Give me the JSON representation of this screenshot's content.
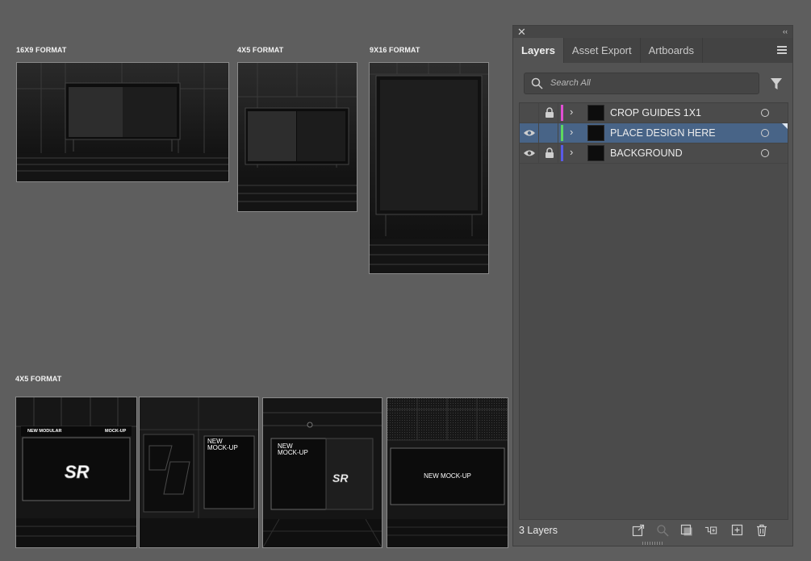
{
  "canvas": {
    "labels": {
      "format_16x9": "16X9 FORMAT",
      "format_4x5_top": "4X5 FORMAT",
      "format_9x16": "9X16 FORMAT",
      "format_4x5_bottom": "4X5 FORMAT"
    },
    "mockups": {
      "m1_left": "NEW MODULAR",
      "m1_right": "MOCK-UP",
      "m2_line1": "NEW",
      "m2_line2": "MOCK-UP",
      "m3_line1": "NEW",
      "m3_line2": "MOCK-UP",
      "m4_title": "NEW MOCK-UP"
    }
  },
  "panel": {
    "tabs": [
      "Layers",
      "Asset Export",
      "Artboards"
    ],
    "search_placeholder": "Search All",
    "layers": [
      {
        "name": "CROP GUIDES 1X1",
        "visible": false,
        "locked": true,
        "color": "#e04fd3",
        "selected": false
      },
      {
        "name": "PLACE DESIGN HERE",
        "visible": true,
        "locked": false,
        "color": "#5ed85e",
        "selected": true
      },
      {
        "name": "BACKGROUND",
        "visible": true,
        "locked": true,
        "color": "#5a5ae6",
        "selected": false
      }
    ],
    "layer_count": "3 Layers",
    "footer_icons": [
      "export-icon",
      "locate-object-icon",
      "clipping-mask-icon",
      "new-sublayer-icon",
      "new-layer-icon",
      "trash-icon"
    ]
  }
}
